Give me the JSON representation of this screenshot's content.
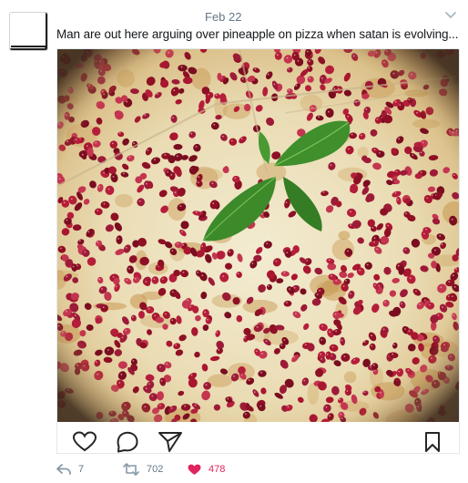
{
  "tweet": {
    "date": "Feb 22",
    "text": "Man are out here arguing over pineapple on pizza when satan is evolving...",
    "media_description_icon": "pizza-photo",
    "embed_icons": [
      "heart-outline-icon",
      "comment-bubble-icon",
      "send-plane-icon",
      "bookmark-icon"
    ],
    "counts": {
      "replies": "7",
      "retweets": "702",
      "likes": "478"
    }
  },
  "colors": {
    "text": "#14171a",
    "muted": "#657786",
    "like": "#e0245e",
    "border": "#e1e8ed"
  }
}
